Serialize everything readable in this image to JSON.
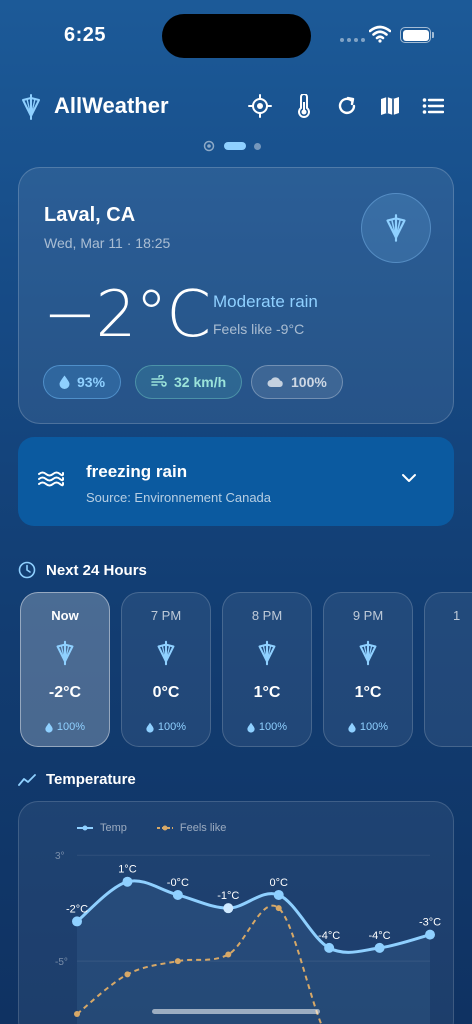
{
  "status": {
    "time": "6:25"
  },
  "header": {
    "title": "AllWeather"
  },
  "current": {
    "city": "Laval, CA",
    "datetime": "Wed, Mar 11 · 18:25",
    "temp": "−2°C",
    "condition": "Moderate rain",
    "feels_like": "Feels like -9°C",
    "humidity": "93%",
    "wind": "32 km/h",
    "cloud": "100%"
  },
  "alert": {
    "title": "freezing rain",
    "source": "Source: Environnement Canada"
  },
  "sections": {
    "hourly": "Next 24 Hours",
    "temperature": "Temperature"
  },
  "hourly": [
    {
      "label": "Now",
      "temp": "-2°C",
      "precip": "100%"
    },
    {
      "label": "7 PM",
      "temp": "0°C",
      "precip": "100%"
    },
    {
      "label": "8 PM",
      "temp": "1°C",
      "precip": "100%"
    },
    {
      "label": "9 PM",
      "temp": "1°C",
      "precip": "100%"
    },
    {
      "label": "1",
      "temp": "",
      "precip": ""
    }
  ],
  "chart_data": {
    "type": "line",
    "legend": [
      "Temp",
      "Feels like"
    ],
    "y_ticks": [
      "3°",
      "-5°"
    ],
    "ylim": [
      -13,
      4
    ],
    "grid": true,
    "series": [
      {
        "name": "Temp",
        "values": [
          -2,
          1,
          0,
          -1,
          0,
          -4,
          -4,
          -3
        ],
        "labels": [
          "-2°C",
          "1°C",
          "-0°C",
          "-1°C",
          "0°C",
          "-4°C",
          "-4°C",
          "-3°C"
        ]
      },
      {
        "name": "Feels like",
        "values": [
          -9,
          -6,
          -5,
          -4.5,
          -1,
          -11,
          -12.5,
          null
        ]
      }
    ]
  },
  "colors": {
    "temp_line": "#8fd0ff",
    "feels_line": "#d7a867",
    "accent": "#8fd0ff",
    "alert_bg": "#0b5aa0"
  }
}
